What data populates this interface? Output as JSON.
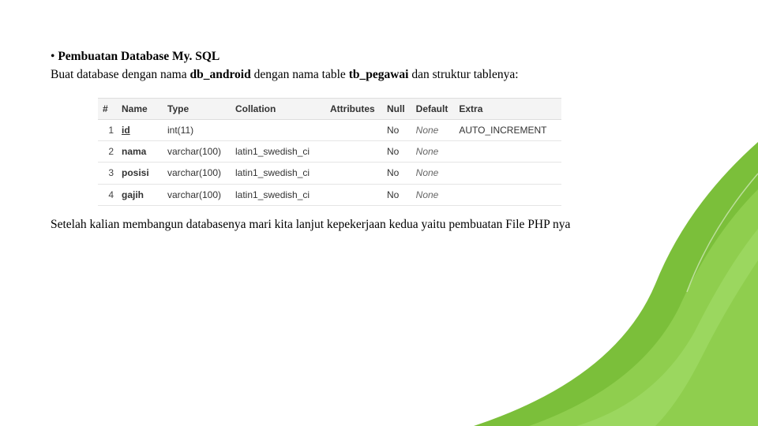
{
  "heading": "Pembuatan Database My. SQL",
  "intro_prefix": "Buat database dengan nama ",
  "db_name": "db_android",
  "intro_mid": " dengan nama table ",
  "table_name": "tb_pegawai",
  "intro_suffix": " dan struktur tablenya:",
  "after_text": "Setelah kalian membangun databasenya mari kita lanjut kepekerjaan kedua yaitu pembuatan File PHP nya",
  "table": {
    "headers": {
      "num": "#",
      "name": "Name",
      "type": "Type",
      "collation": "Collation",
      "attributes": "Attributes",
      "null": "Null",
      "default": "Default",
      "extra": "Extra"
    },
    "rows": [
      {
        "num": "1",
        "name": "id",
        "underline": true,
        "type": "int(11)",
        "collation": "",
        "attributes": "",
        "null": "No",
        "default": "None",
        "extra": "AUTO_INCREMENT"
      },
      {
        "num": "2",
        "name": "nama",
        "underline": false,
        "type": "varchar(100)",
        "collation": "latin1_swedish_ci",
        "attributes": "",
        "null": "No",
        "default": "None",
        "extra": ""
      },
      {
        "num": "3",
        "name": "posisi",
        "underline": false,
        "type": "varchar(100)",
        "collation": "latin1_swedish_ci",
        "attributes": "",
        "null": "No",
        "default": "None",
        "extra": ""
      },
      {
        "num": "4",
        "name": "gajih",
        "underline": false,
        "type": "varchar(100)",
        "collation": "latin1_swedish_ci",
        "attributes": "",
        "null": "No",
        "default": "None",
        "extra": ""
      }
    ]
  }
}
